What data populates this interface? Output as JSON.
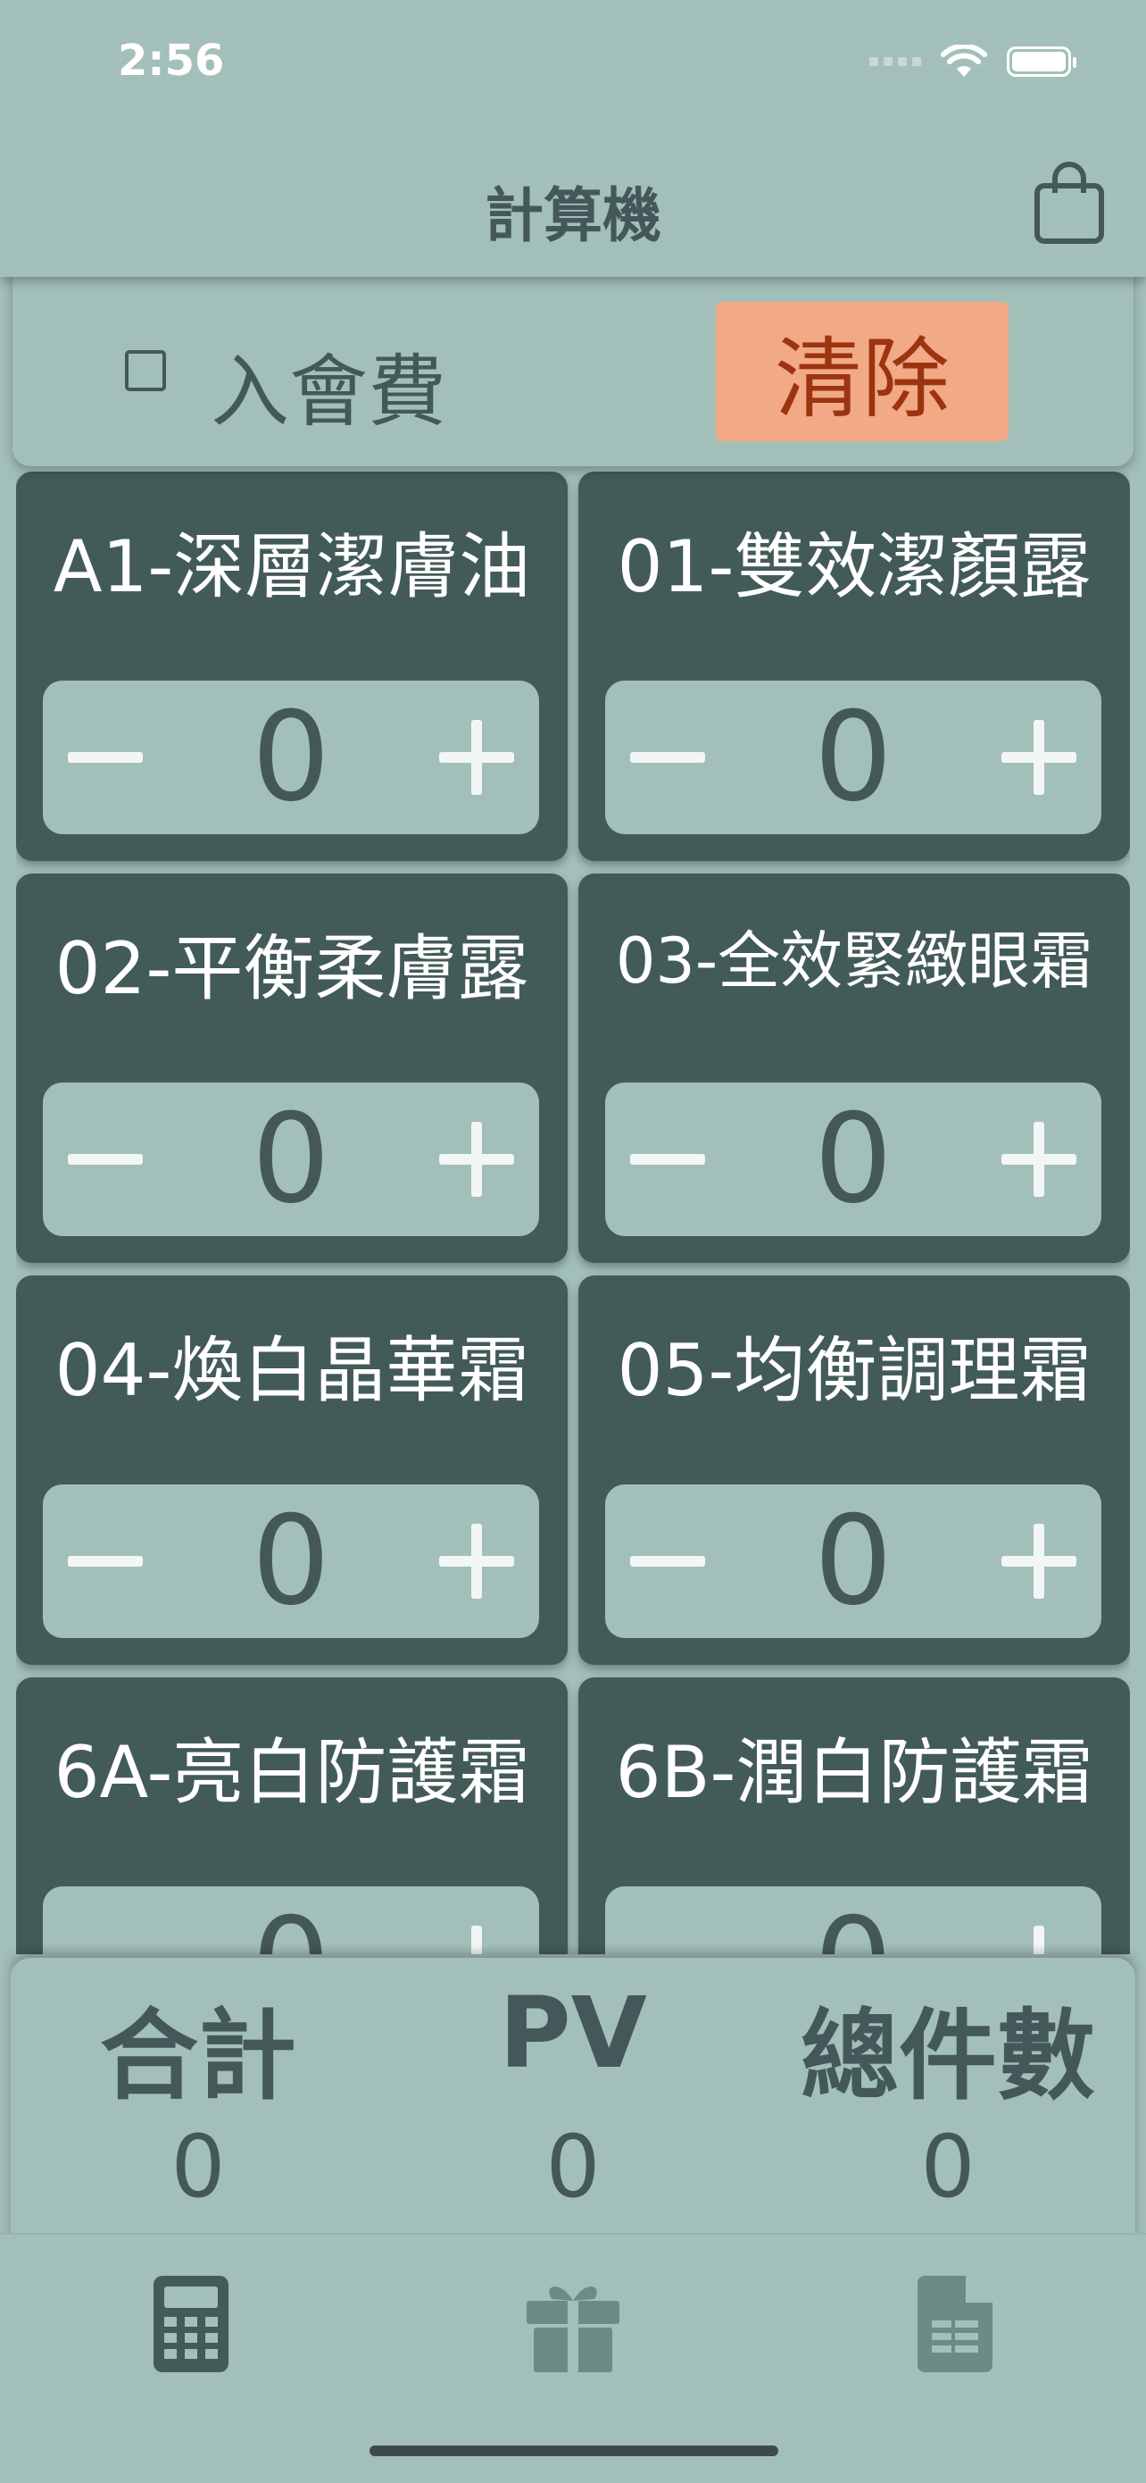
{
  "status": {
    "time": "2:56"
  },
  "header": {
    "title": "計算機",
    "cart_icon": "shopping-bag-icon"
  },
  "membership": {
    "checkbox_label": "入會費",
    "checked": false,
    "clear_label": "清除"
  },
  "products": [
    {
      "name": "A1-深層潔膚油",
      "qty": "0"
    },
    {
      "name": "01-雙效潔顏露",
      "qty": "0"
    },
    {
      "name": "02-平衡柔膚露",
      "qty": "0"
    },
    {
      "name": "03-全效緊緻眼霜",
      "qty": "0"
    },
    {
      "name": "04-煥白晶華霜",
      "qty": "0"
    },
    {
      "name": "05-均衡調理霜",
      "qty": "0"
    },
    {
      "name": "6A-亮白防護霜",
      "qty": "0"
    },
    {
      "name": "6B-潤白防護霜",
      "qty": "0"
    }
  ],
  "totals": {
    "sum_label": "合計",
    "sum_value": "0",
    "pv_label": "PV",
    "pv_value": "0",
    "count_label": "總件數",
    "count_value": "0"
  },
  "tabs": [
    {
      "icon": "calculator-icon",
      "active": true
    },
    {
      "icon": "gift-icon",
      "active": false
    },
    {
      "icon": "document-icon",
      "active": false
    }
  ],
  "colors": {
    "background": "#a3bfba",
    "card": "#435b58",
    "text": "#44585a",
    "clear_button": "#f2a985",
    "clear_text": "#9c3410"
  }
}
